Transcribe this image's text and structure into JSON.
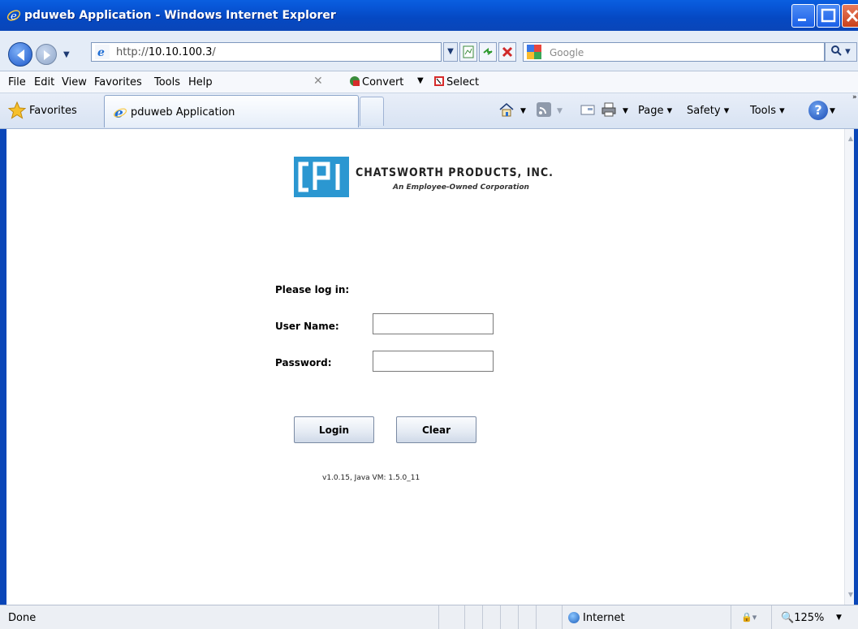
{
  "window": {
    "title": "pduweb Application - Windows Internet Explorer"
  },
  "address_bar": {
    "url_prefix": "http://",
    "url_host": "10.10.100.3",
    "url_suffix": "/",
    "search_placeholder": "Google"
  },
  "menu": {
    "items": [
      "File",
      "Edit",
      "View",
      "Favorites",
      "Tools",
      "Help"
    ],
    "convert_label": "Convert",
    "select_label": "Select"
  },
  "favorites_bar": {
    "favorites_label": "Favorites",
    "tab_label": "pduweb Application",
    "commands": [
      "Page",
      "Safety",
      "Tools"
    ]
  },
  "page": {
    "logo_name": "CHATSWORTH PRODUCTS, INC.",
    "logo_tagline": "An Employee-Owned Corporation",
    "login_heading": "Please log in:",
    "username_label": "User Name:",
    "password_label": "Password:",
    "username_value": "",
    "password_value": "",
    "login_button": "Login",
    "clear_button": "Clear",
    "version": "v1.0.15, Java VM: 1.5.0_11"
  },
  "status_bar": {
    "status": "Done",
    "zone": "Internet",
    "zoom": "125%"
  },
  "colors": {
    "titlebar": "#0548c2",
    "logo_blue": "#2b97d1"
  }
}
